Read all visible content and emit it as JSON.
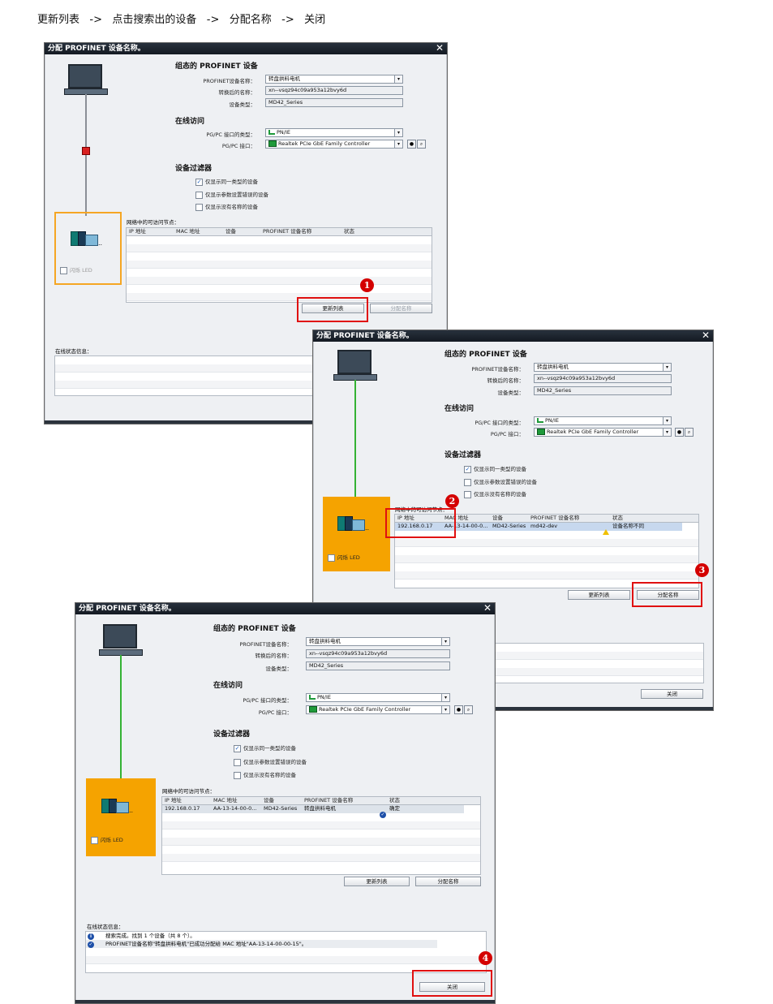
{
  "steps_caption": "更新列表   ->   点击搜索出的设备   ->   分配名称   ->   关闭",
  "dialog": {
    "title": "分配 PROFINET 设备名称。",
    "close": "✕",
    "configured_section": "组态的 PROFINET 设备",
    "device_name_label": "PROFINET设备名称：",
    "device_name_value": "转盘拱料电机",
    "converted_label": "转换后的名称：",
    "converted_value": "xn--vsqz94c09a953a12bvy6d",
    "device_type_label": "设备类型：",
    "device_type_value": "MD42_Series",
    "online_section": "在线访问",
    "ifc_type_label": "PG/PC 接口的类型：",
    "ifc_type_value": "PN/IE",
    "ifc_label": "PG/PC 接口：",
    "ifc_value": "Realtek PCIe GbE Family Controller",
    "filter_section": "设备过滤器",
    "filter_same_type": "仅显示同一类型的设备",
    "filter_param_err": "仅显示参数设置错误的设备",
    "filter_no_name": "仅显示没有名称的设备",
    "nodes_label": "网络中的可访问节点：",
    "col_ip": "IP 地址",
    "col_mac": "MAC 地址",
    "col_device": "设备",
    "col_pn_name": "PROFINET 设备名称",
    "col_status": "状态",
    "blink_led": "闪烁 LED",
    "update_list": "更新列表",
    "assign_name": "分配名称",
    "online_status_label": "在线状态信息：",
    "close_btn": "关闭"
  },
  "dialog2_row": {
    "ip": "192.168.0.17",
    "mac": "AA-13-14-00-0...",
    "device": "MD42-Series",
    "pn_name": "md42-dev",
    "status": "设备名称不同"
  },
  "dialog3_row": {
    "ip": "192.168.0.17",
    "mac": "AA-13-14-00-0...",
    "device": "MD42-Series",
    "pn_name": "转盘拱料电机",
    "status": "确定"
  },
  "status_messages": [
    "搜索完成。找到 1 个设备（共 8 个）。",
    "PROFINET设备名称\"转盘拱料电机\"已成功分配给 MAC 地址\"AA-13-14-00-00-15\"。"
  ],
  "markers": [
    "1",
    "2",
    "3",
    "4"
  ],
  "colors": {
    "highlight_red": "#e01010",
    "device_orange": "#f5a300",
    "link_green": "#34b233"
  }
}
